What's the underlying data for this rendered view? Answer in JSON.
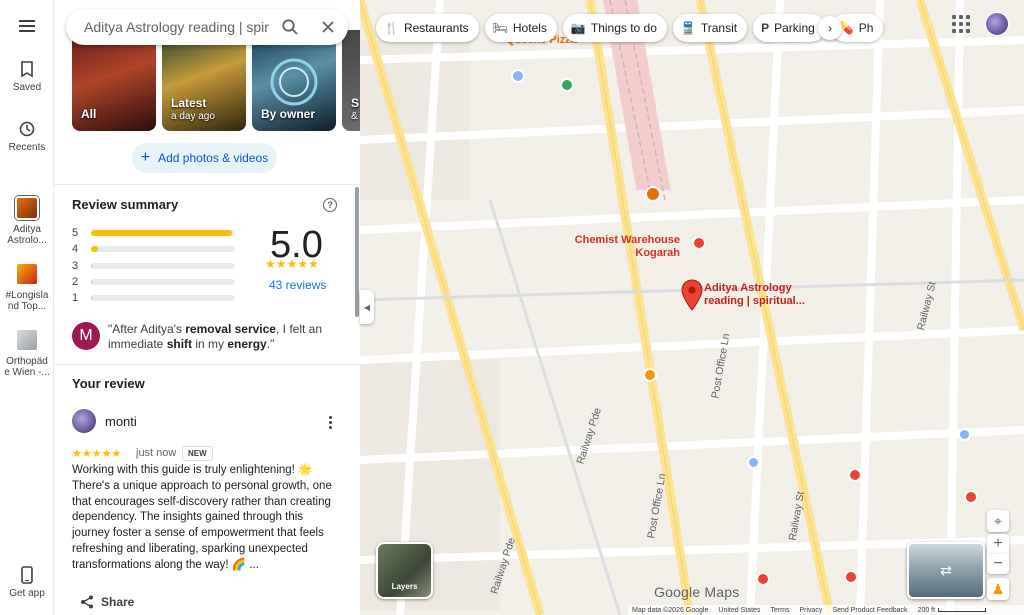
{
  "rail": {
    "saved": "Saved",
    "recents": "Recents",
    "items": [
      {
        "label": "Aditya Astrolo..."
      },
      {
        "label": "#Longisla nd Top..."
      },
      {
        "label": "Orthopäd e Wien -..."
      }
    ],
    "get_app": "Get app"
  },
  "search": {
    "value": "Aditya Astrology reading | spiritual h"
  },
  "photos": [
    {
      "label": "All",
      "sub": ""
    },
    {
      "label": "Latest",
      "sub": "a day ago"
    },
    {
      "label": "By owner",
      "sub": ""
    },
    {
      "label": "S",
      "sub": "&"
    }
  ],
  "add_photos": "Add photos & videos",
  "review_summary": {
    "title": "Review summary",
    "rating": "5.0",
    "stars": "★★★★★",
    "count": "43 reviews",
    "bars": [
      {
        "label": "5",
        "fraction": 0.98
      },
      {
        "label": "4",
        "fraction": 0.05
      },
      {
        "label": "3",
        "fraction": 0.01
      },
      {
        "label": "2",
        "fraction": 0.01
      },
      {
        "label": "1",
        "fraction": 0.01
      }
    ],
    "quote_initial": "M",
    "quote": {
      "p1": "\"After Aditya's ",
      "b1": "removal service",
      "p2": ", I felt an immediate ",
      "b2": "shift",
      "p3": " in my ",
      "b3": "energy",
      "p4": ".\""
    }
  },
  "your_review": {
    "title": "Your review",
    "name": "monti",
    "stars": "★★★★★",
    "time": "just now",
    "badge": "NEW",
    "text": "Working with this guide is truly enlightening! 🌟 There's a unique approach to personal growth, one that encourages self-discovery rather than creating dependency. The insights gained through this journey foster a sense of empowerment that feels refreshing and liberating, sparking unexpected transformations along the way! 🌈 ...",
    "share": "Share"
  },
  "chips": [
    {
      "icon": "restaurant-icon",
      "glyph": "🍴",
      "label": "Restaurants"
    },
    {
      "icon": "hotel-icon",
      "glyph": "🛏",
      "label": "Hotels"
    },
    {
      "icon": "camera-icon",
      "glyph": "📷",
      "label": "Things to do"
    },
    {
      "icon": "transit-icon",
      "glyph": "🚆",
      "label": "Transit"
    },
    {
      "icon": "parking-icon",
      "glyph": "P",
      "label": "Parking"
    },
    {
      "icon": "pharmacy-icon",
      "glyph": "💊",
      "label": "Ph"
    }
  ],
  "map": {
    "places": [
      {
        "name": "Queens Pizza",
        "color": "#e8710a"
      },
      {
        "name": "Chemist Warehouse Kogarah",
        "color": "#d93025"
      },
      {
        "name": "Aditya Astrology reading | spiritual...",
        "color": "#c5221f"
      },
      {
        "name": "Kogarah",
        "color": "#ea4335"
      }
    ],
    "streets": [
      "Post Office Ln",
      "Post Office Ln",
      "Railway Pde",
      "Railway Pde",
      "Railway St",
      "Railway St"
    ],
    "layers_label": "Layers",
    "logo": "Google Maps",
    "footer": [
      "Map data ©2026 Google",
      "United States",
      "Terms",
      "Privacy",
      "Send Product Feedback",
      "200 ft"
    ]
  },
  "colors": {
    "accent": "#1a73e8",
    "star": "#fbbc04",
    "pin": "#ea4335"
  }
}
